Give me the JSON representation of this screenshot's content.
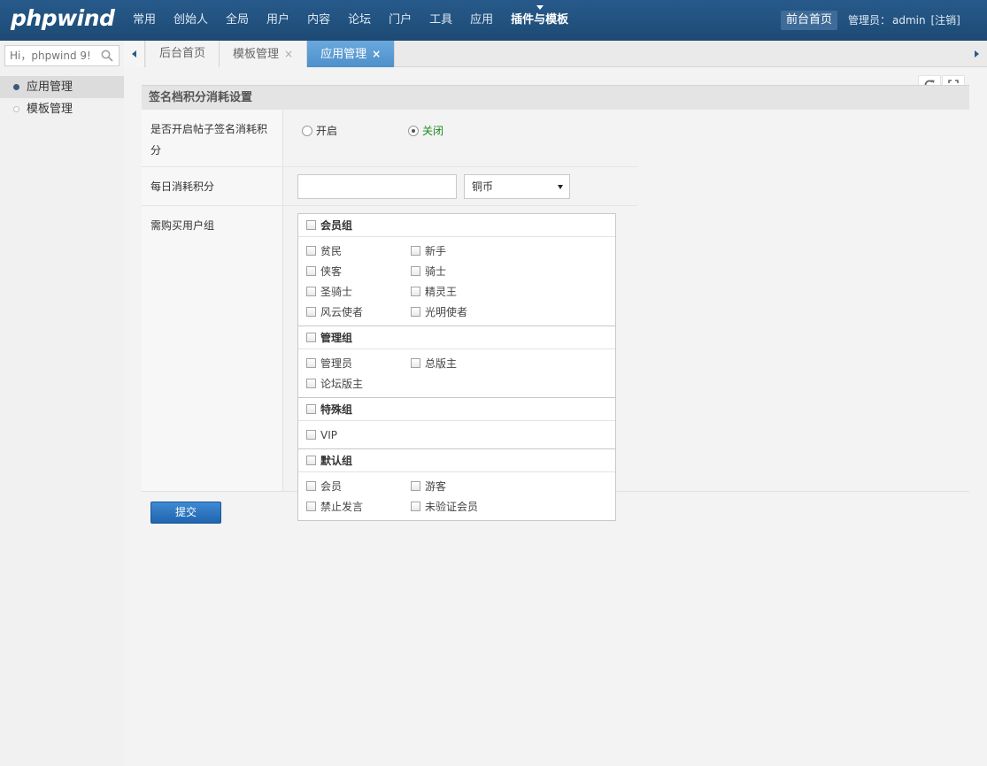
{
  "brand": {
    "logo": "phpwind"
  },
  "nav": {
    "items": [
      {
        "label": "常用"
      },
      {
        "label": "创始人"
      },
      {
        "label": "全局"
      },
      {
        "label": "用户"
      },
      {
        "label": "内容"
      },
      {
        "label": "论坛"
      },
      {
        "label": "门户"
      },
      {
        "label": "工具"
      },
      {
        "label": "应用"
      },
      {
        "label": "插件与模板"
      }
    ],
    "active_index": 9,
    "front_home": "前台首页",
    "admin_prefix": "管理员：",
    "admin_name": "admin",
    "logout": "[注销]"
  },
  "sidebar": {
    "search": {
      "placeholder": "Hi，phpwind 9!"
    },
    "items": [
      {
        "label": "应用管理"
      },
      {
        "label": "模板管理"
      }
    ]
  },
  "tabs": [
    {
      "label": "后台首页"
    },
    {
      "label": "模板管理",
      "close": "×"
    },
    {
      "label": "应用管理",
      "close": "×"
    }
  ],
  "section": {
    "title": "签名档积分消耗设置"
  },
  "form": {
    "enable": {
      "label": "是否开启帖子签名消耗积分",
      "on_label": "开启",
      "off_label": "关闭",
      "selected": "关闭"
    },
    "daily": {
      "label": "每日消耗积分",
      "value": "",
      "currency": "铜币"
    },
    "groups": {
      "label": "需购买用户组",
      "sections": [
        {
          "title": "会员组",
          "options": [
            "贫民",
            "新手",
            "侠客",
            "骑士",
            "圣骑士",
            "精灵王",
            "风云使者",
            "光明使者"
          ]
        },
        {
          "title": "管理组",
          "options": [
            "管理员",
            "总版主",
            "论坛版主"
          ]
        },
        {
          "title": "特殊组",
          "options": [
            "VIP"
          ]
        },
        {
          "title": "默认组",
          "options": [
            "会员",
            "游客",
            "禁止发言",
            "未验证会员"
          ]
        }
      ]
    },
    "submit": "提交"
  },
  "colors": {
    "topbar": "#275a8b",
    "tab_active": "#5b9bd5",
    "selected_radio_label": "#1b8a1b",
    "submit": "#2a76c2"
  }
}
